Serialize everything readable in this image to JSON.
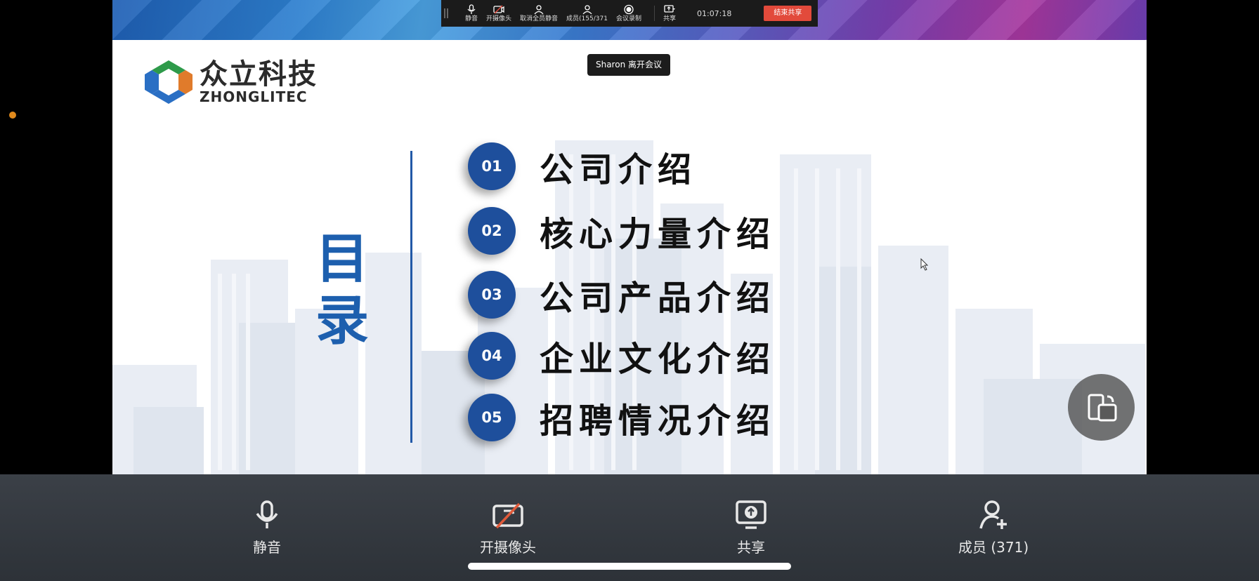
{
  "meeting_toolbar": {
    "buttons": [
      {
        "label": "静音",
        "icon": "mic-icon"
      },
      {
        "label": "开摄像头",
        "icon": "camera-off-icon"
      },
      {
        "label": "取消全员静音",
        "icon": "unmute-all-icon"
      },
      {
        "label": "成员(155/371",
        "icon": "members-icon"
      },
      {
        "label": "会议录制",
        "icon": "record-icon"
      }
    ],
    "share_label": "共享",
    "timer": "01:07:18",
    "end_share_label": "结束共享"
  },
  "toast": "Sharon 离开会议",
  "slide": {
    "logo_cn": "众立科技",
    "logo_en": "ZHONGLITEC",
    "toc_title_line1": "目",
    "toc_title_line2": "录",
    "items": [
      {
        "num": "01",
        "label": "公司介绍"
      },
      {
        "num": "02",
        "label": "核心力量介绍"
      },
      {
        "num": "03",
        "label": "公司产品介绍"
      },
      {
        "num": "04",
        "label": "企业文化介绍"
      },
      {
        "num": "05",
        "label": "招聘情况介绍"
      }
    ]
  },
  "bottom_bar": {
    "mute_label": "静音",
    "camera_label": "开摄像头",
    "share_label": "共享",
    "members_label": "成员 (371)"
  },
  "colors": {
    "accent_blue": "#1e4f9c",
    "end_share_red": "#e24a3b",
    "status_dot": "#e08a1c"
  }
}
